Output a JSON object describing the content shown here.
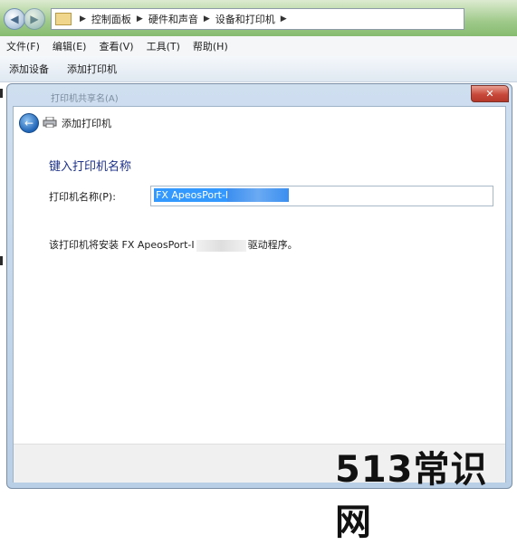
{
  "breadcrumb": {
    "items": [
      "控制面板",
      "硬件和声音",
      "设备和打印机"
    ]
  },
  "menu": [
    "文件(F)",
    "编辑(E)",
    "查看(V)",
    "工具(T)",
    "帮助(H)"
  ],
  "toolbar": [
    "添加设备",
    "添加打印机"
  ],
  "dialog": {
    "title": "打印机共享名(A)",
    "close_glyph": "✕",
    "wizard_title": "添加打印机",
    "heading": "键入打印机名称",
    "name_label": "打印机名称(P):",
    "name_value": "FX ApeosPort-I",
    "driver_prefix": "该打印机将安装 FX ApeosPort-I",
    "driver_suffix": "驱动程序。"
  },
  "watermark": "513常识网",
  "icons": {
    "back": "arrow-left-icon",
    "forward": "arrow-right-icon",
    "printer": "printer-icon",
    "folder": "folder-icon"
  }
}
